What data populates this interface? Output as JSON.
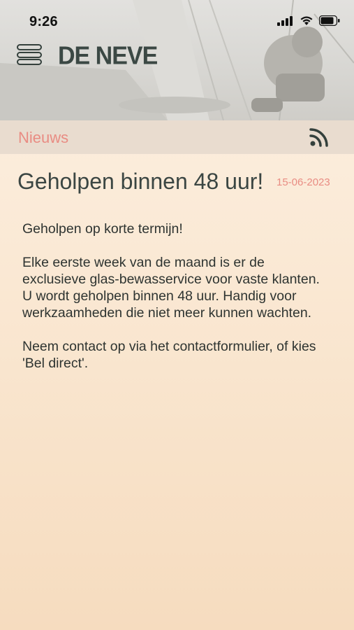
{
  "status_bar": {
    "time": "9:26",
    "icons": [
      "signal-icon",
      "wifi-icon",
      "battery-icon"
    ]
  },
  "header": {
    "menu_icon": "hamburger-menu-icon",
    "logo_text": "DE NEVE"
  },
  "section": {
    "title": "Nieuws",
    "feed_icon": "rss-feed-icon"
  },
  "article": {
    "title": "Geholpen binnen 48 uur!",
    "date": "15-06-2023",
    "paragraphs": [
      "Geholpen op korte termijn!",
      "Elke eerste week van de maand is er de exclusieve glas-bewasservice voor vaste klanten. U wordt geholpen binnen 48 uur. Handig voor werkzaamheden die niet meer kunnen wachten.",
      "Neem contact op via het contactformulier, of kies 'Bel direct'."
    ]
  },
  "colors": {
    "accent": "#e98c83",
    "text_dark": "#3b4643",
    "section_bar": "#e9dccf"
  }
}
